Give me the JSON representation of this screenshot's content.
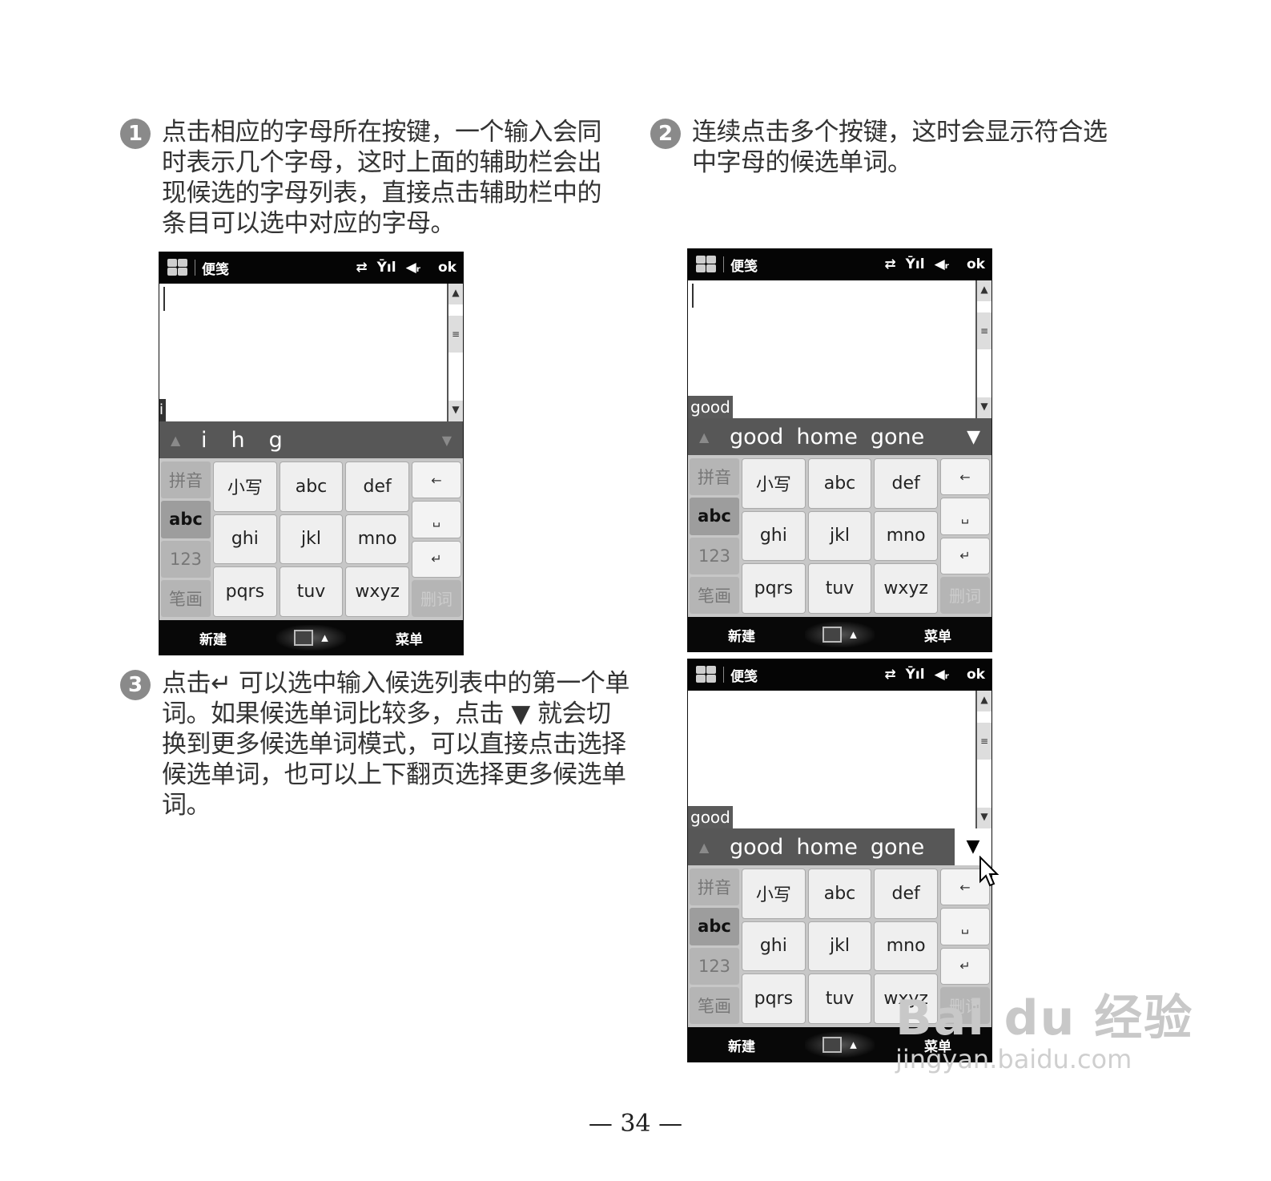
{
  "steps": [
    {
      "num": "1",
      "text": "点击相应的字母所在按键，一个输入会同时表示几个字母，这时上面的辅助栏会出现候选的字母列表，直接点击辅助栏中的条目可以选中对应的字母。"
    },
    {
      "num": "2",
      "text": "连续点击多个按键，这时会显示符合选中字母的候选单词。"
    },
    {
      "num": "3",
      "text": "点击↵ 可以选中输入候选列表中的第一个单词。如果候选单词比较多，点击 ▼ 就会切换到更多候选单词模式，可以直接点击选择候选单词，也可以上下翻页选择更多候选单词。"
    }
  ],
  "screen": {
    "app_title": "便笺",
    "ok": "ok",
    "status_icons": [
      "sync-icon",
      "signal-icon",
      "volume-icon"
    ],
    "mode_keys": [
      "拼音",
      "abc",
      "123",
      "笔画"
    ],
    "keys": [
      "小写",
      "abc",
      "def",
      "ghi",
      "jkl",
      "mno",
      "pqrs",
      "tuv",
      "wxyz"
    ],
    "func_keys": [
      "←",
      "␣",
      "↵",
      "删词"
    ],
    "softkey_left": "新建",
    "softkey_right": "菜单"
  },
  "screen1": {
    "composing": "i",
    "candidates": [
      "i",
      "h",
      "g"
    ]
  },
  "screen2": {
    "composing": "good",
    "candidates": [
      "good",
      "home",
      "gone"
    ]
  },
  "screen3": {
    "composing": "good",
    "candidates": [
      "good",
      "home",
      "gone"
    ]
  },
  "page_number": "— 34 —",
  "watermark": {
    "logo": "Bai du 经验",
    "url": "jingyan.baidu.com"
  }
}
